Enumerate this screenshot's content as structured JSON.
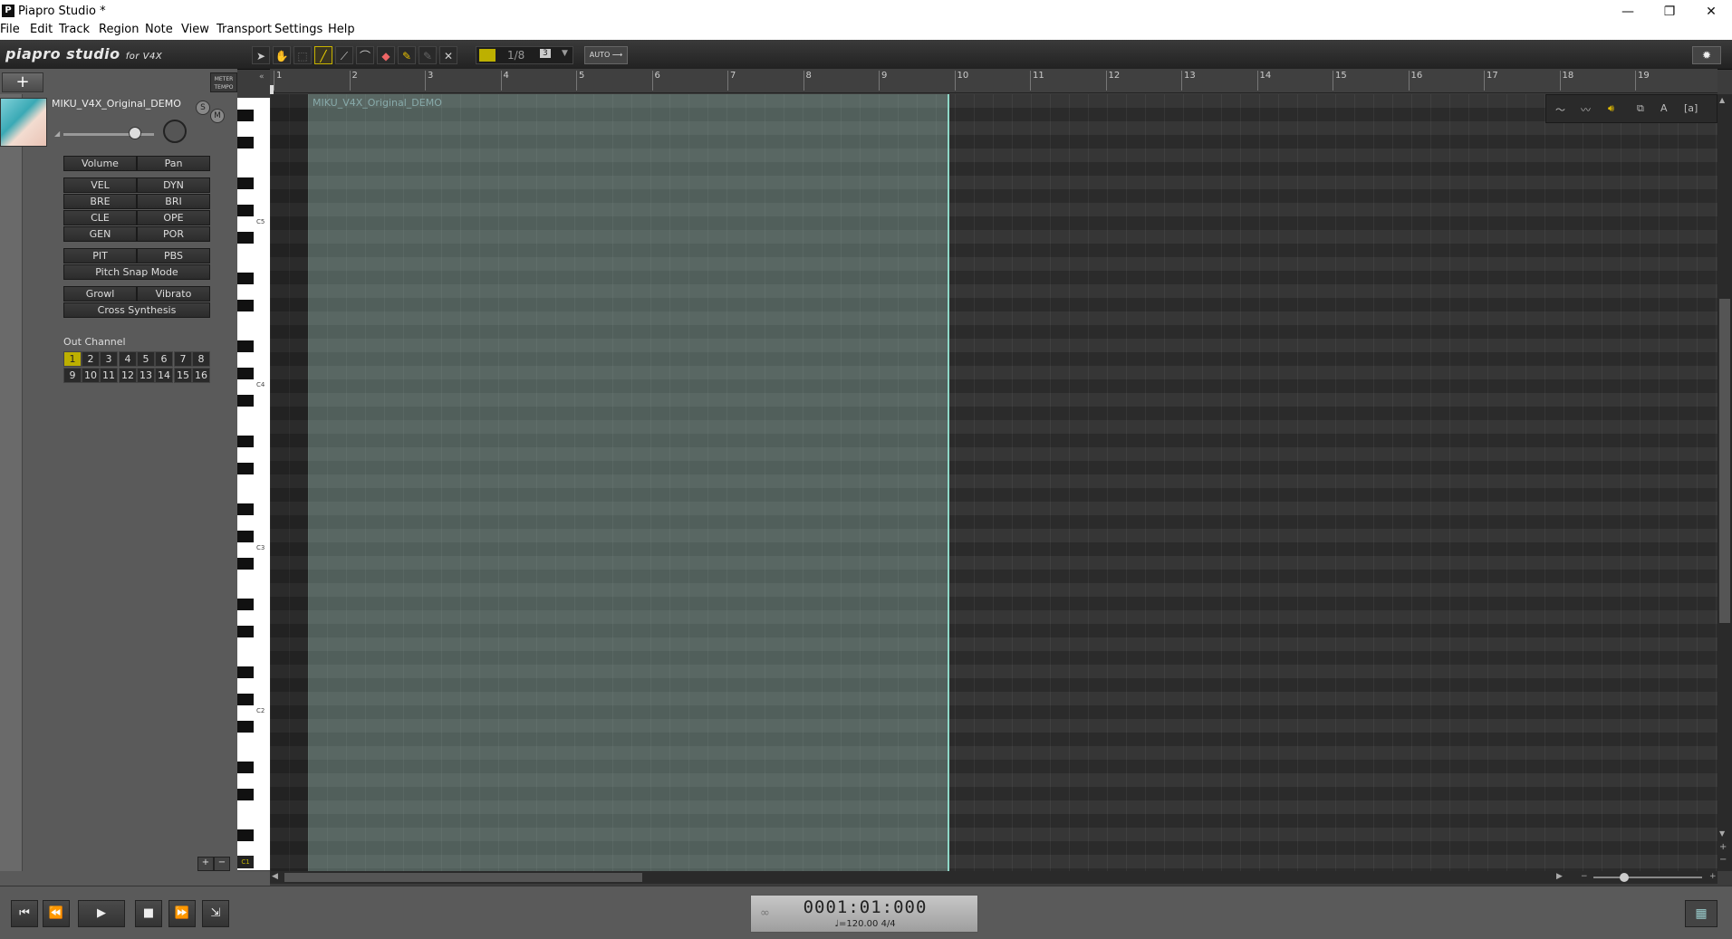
{
  "window": {
    "title": "Piapro Studio *",
    "app_icon": "P",
    "minimize": "—",
    "restore": "❐",
    "close": "✕"
  },
  "menu": [
    "File",
    "Edit",
    "Track",
    "Region",
    "Note",
    "View",
    "Transport",
    "Settings",
    "Help"
  ],
  "toolbar": {
    "logo": "piapro studio",
    "logo_suffix": "for V4X",
    "quantize": "1/8",
    "quantize_extra": "3",
    "auto_label": "AUTO ⟶",
    "settings_icon": "gear-icon",
    "tools": [
      "arrow-icon",
      "grab-icon",
      "select-icon",
      "pencil-icon",
      "line-icon",
      "curve-icon",
      "eraser-icon",
      "brush-icon",
      "pen-disabled-icon",
      "close-icon"
    ]
  },
  "track": {
    "add_label": "+",
    "meter_tempo": "METER TEMPO",
    "name": "MIKU_V4X_Original_DEMO",
    "solo": "S",
    "mute": "M",
    "buttons": {
      "volume": "Volume",
      "pan": "Pan",
      "vel": "VEL",
      "dyn": "DYN",
      "bre": "BRE",
      "bri": "BRI",
      "cle": "CLE",
      "ope": "OPE",
      "gen": "GEN",
      "por": "POR",
      "pit": "PIT",
      "pbs": "PBS",
      "pitch_snap": "Pitch Snap Mode",
      "growl": "Growl",
      "vibrato": "Vibrato",
      "cross_synthesis": "Cross Synthesis"
    },
    "out_channel_label": "Out Channel",
    "channels": [
      "1",
      "2",
      "3",
      "4",
      "5",
      "6",
      "7",
      "8",
      "9",
      "10",
      "11",
      "12",
      "13",
      "14",
      "15",
      "16"
    ],
    "selected_channel": "1"
  },
  "keyboard": {
    "octave_labels": [
      "C5",
      "C4",
      "C3",
      "C2",
      "C1"
    ]
  },
  "ruler": {
    "bars": [
      "1",
      "2",
      "3",
      "4",
      "5",
      "6",
      "7",
      "8",
      "9",
      "10",
      "11",
      "12",
      "13",
      "14",
      "15",
      "16",
      "17",
      "18",
      "19"
    ]
  },
  "region": {
    "label": "MIKU_V4X_Original_DEMO",
    "color": "#8fd8c8"
  },
  "grid_tools": [
    "curve-a-icon",
    "curve-b-icon",
    "speaker-icon",
    "copy-icon",
    "text-icon",
    "bracket-icon"
  ],
  "transport": {
    "time": "0001:01:000",
    "tempo": "♩=120.00  4/4",
    "buttons": [
      "skip-start-icon",
      "rewind-icon",
      "play-icon",
      "stop-icon",
      "fast-forward-icon",
      "loop-end-icon"
    ]
  },
  "colors": {
    "accent": "#bdb000",
    "region": "#8fd8c8",
    "keyboard_edge": "#dd4444"
  }
}
